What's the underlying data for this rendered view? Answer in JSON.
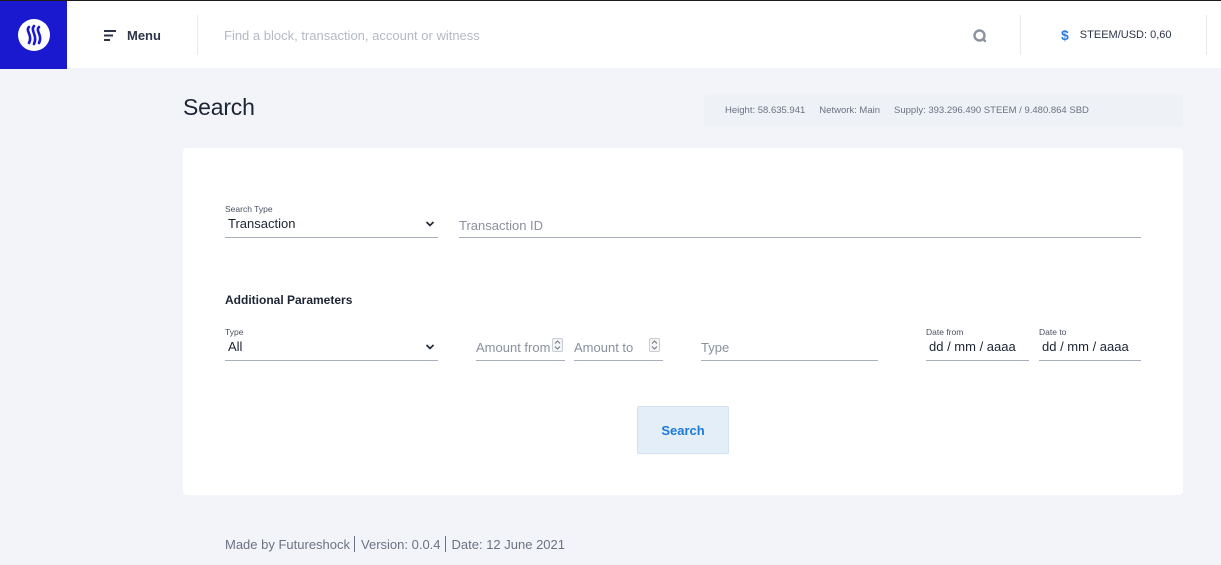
{
  "header": {
    "menu_label": "Menu",
    "search_placeholder": "Find a block, transaction, account or witness",
    "price_label": "STEEM/USD: 0,60"
  },
  "page": {
    "title": "Search",
    "stats": {
      "height": "Height: 58.635.941",
      "network": "Network: Main",
      "supply": "Supply: 393.296.490 STEEM / 9.480.864 SBD"
    }
  },
  "form": {
    "search_type_label": "Search Type",
    "search_type_value": "Transaction",
    "transaction_id_placeholder": "Transaction ID",
    "additional_title": "Additional Parameters",
    "type_label": "Type",
    "type_value": "All",
    "amount_from_placeholder": "Amount from",
    "amount_to_placeholder": "Amount to",
    "op_type_placeholder": "Type",
    "date_from_label": "Date from",
    "date_from_value": "dd / mm / aaaa",
    "date_to_label": "Date to",
    "date_to_value": "dd / mm / aaaa",
    "search_button": "Search"
  },
  "footer": {
    "made_by": "Made by Futureshock",
    "version": "Version: 0.0.4",
    "date": "Date: 12 June 2021"
  },
  "colors": {
    "brand": "#1a19d0",
    "accent": "#1d7ad7",
    "background": "#f2f4f9"
  },
  "icons": [
    "steem-logo-icon",
    "menu-icon",
    "search-icon",
    "dollar-icon",
    "chevron-down-icon",
    "spinner-icon"
  ]
}
